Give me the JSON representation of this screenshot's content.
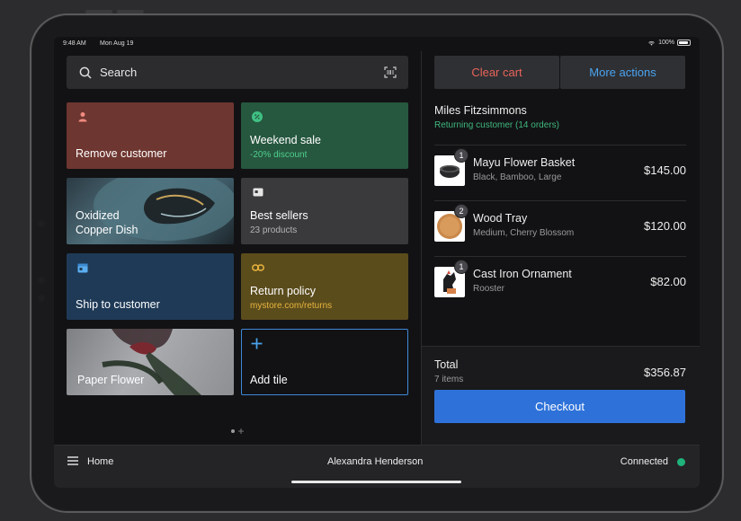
{
  "status_bar": {
    "time": "9:48 AM",
    "date": "Mon Aug 19",
    "battery": "100%"
  },
  "search": {
    "placeholder": "Search"
  },
  "tiles": [
    {
      "label": "Remove customer",
      "sub": "",
      "icon": "person-icon"
    },
    {
      "label": "Weekend sale",
      "sub": "-20% discount",
      "icon": "discount-icon"
    },
    {
      "label": "Oxidized\nCopper Dish",
      "sub": "",
      "icon": ""
    },
    {
      "label": "Best sellers",
      "sub": "23 products",
      "icon": "folder-icon"
    },
    {
      "label": "Ship to customer",
      "sub": "",
      "icon": "calendar-icon"
    },
    {
      "label": "Return policy",
      "sub": "mystore.com/returns",
      "icon": "link-icon"
    },
    {
      "label": "Paper Flower",
      "sub": "",
      "icon": ""
    },
    {
      "label": "Add tile",
      "sub": "",
      "icon": "plus-icon"
    }
  ],
  "cart": {
    "clear_label": "Clear cart",
    "more_label": "More actions",
    "customer_name": "Miles Fitzsimmons",
    "customer_sub": "Returning customer (14 orders)",
    "items": [
      {
        "qty": "1",
        "name": "Mayu Flower Basket",
        "variant": "Black, Bamboo, Large",
        "price": "$145.00"
      },
      {
        "qty": "2",
        "name": "Wood Tray",
        "variant": "Medium, Cherry Blossom",
        "price": "$120.00"
      },
      {
        "qty": "1",
        "name": "Cast Iron Ornament",
        "variant": "Rooster",
        "price": "$82.00"
      }
    ],
    "total_label": "Total",
    "total_count": "7 items",
    "total_value": "$356.87",
    "checkout_label": "Checkout"
  },
  "bottom_bar": {
    "home_label": "Home",
    "user_name": "Alexandra Henderson",
    "connection_label": "Connected"
  },
  "colors": {
    "accent_blue": "#2e72d9",
    "danger_red": "#e86459",
    "success_green": "#3fb77e",
    "link_blue": "#4aa3ee"
  }
}
